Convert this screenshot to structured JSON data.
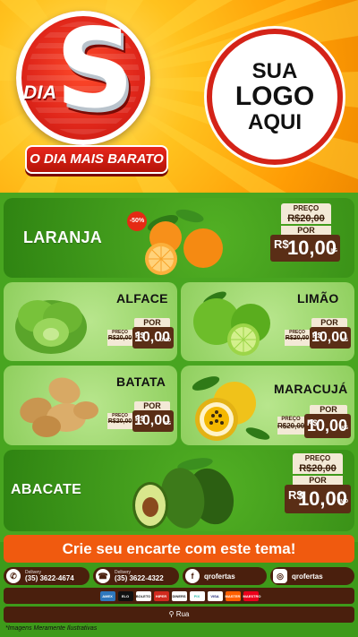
{
  "brand": {
    "dia": "DIA",
    "s": "S",
    "slogan": "O DIA MAIS BARATO"
  },
  "logo_placeholder": {
    "line1": "SUA",
    "line2": "LOGO",
    "line3": "AQUI"
  },
  "products": [
    {
      "name": "LARANJA",
      "badge": "-50%",
      "preco_label": "PREÇO",
      "old_price": "R$20,00",
      "por_label": "POR",
      "currency": "R$",
      "price": "10,00",
      "unit": "KG"
    },
    {
      "name": "ALFACE",
      "preco_label": "PREÇO",
      "old_price": "R$20,00",
      "por_label": "POR",
      "currency": "R$",
      "price": "10,00",
      "unit": "UNID"
    },
    {
      "name": "LIMÃO",
      "preco_label": "PREÇO",
      "old_price": "R$20,00",
      "por_label": "POR",
      "currency": "R$",
      "price": "10,00",
      "unit": "KG"
    },
    {
      "name": "BATATA",
      "preco_label": "PREÇO",
      "old_price": "R$20,00",
      "por_label": "POR",
      "currency": "R$",
      "price": "10,00",
      "unit": "KG"
    },
    {
      "name": "MARACUJÁ",
      "preco_label": "PREÇO",
      "old_price": "R$20,00",
      "por_label": "POR",
      "currency": "R$",
      "price": "10,00",
      "unit": "KG"
    },
    {
      "name": "ABACATE",
      "preco_label": "PREÇO",
      "old_price": "R$20,00",
      "por_label": "POR",
      "currency": "R$",
      "price": "10,00",
      "unit": "UNID"
    }
  ],
  "cta": "Crie seu encarte com este tema!",
  "contacts": [
    {
      "label": "Delivery",
      "value": "(35) 3622-4674",
      "icon": "whatsapp-icon"
    },
    {
      "label": "Delivery",
      "value": "(35) 3622-4322",
      "icon": "phone-icon"
    },
    {
      "label": "",
      "value": "qrofertas",
      "icon": "facebook-icon"
    },
    {
      "label": "",
      "value": "qrofertas",
      "icon": "instagram-icon"
    }
  ],
  "payments": [
    "AMEX",
    "ELO",
    "BOLETO",
    "HIPER",
    "DINERS",
    "PIX",
    "VISA",
    "MASTER",
    "MAESTRO"
  ],
  "address": "Rua",
  "disclaimer": "*Imagens Meramente Ilustrativas",
  "colors": {
    "orange_bg": "#ffa50a",
    "red_logo": "#d42318",
    "green_bg": "#48a520",
    "brown_tag": "#5a2e16",
    "cta_orange": "#f05a0f"
  }
}
